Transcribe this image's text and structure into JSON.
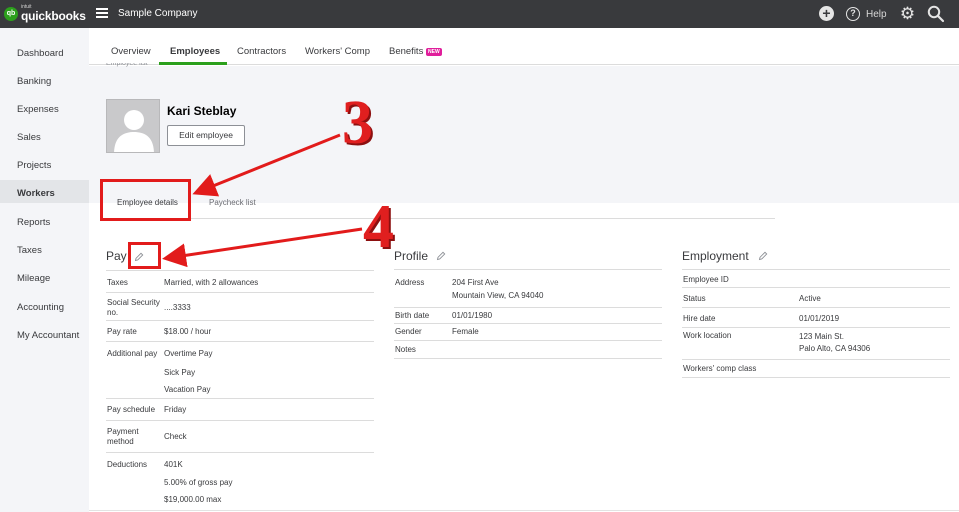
{
  "app": {
    "logo_intuit": "intuit",
    "logo_name": "quickbooks",
    "logo_mark": "qb",
    "company_name": "Sample Company",
    "help_label": "Help",
    "icons": [
      "hamburger-menu-icon",
      "plus-icon",
      "help-icon",
      "gear-icon",
      "search-icon"
    ]
  },
  "sidebar": {
    "items": [
      {
        "label": "Dashboard"
      },
      {
        "label": "Banking"
      },
      {
        "label": "Expenses"
      },
      {
        "label": "Sales"
      },
      {
        "label": "Projects"
      },
      {
        "label": "Workers",
        "active": true
      },
      {
        "label": "Reports"
      },
      {
        "label": "Taxes"
      },
      {
        "label": "Mileage"
      },
      {
        "label": "Accounting"
      },
      {
        "label": "My Accountant"
      }
    ]
  },
  "tabs": [
    {
      "label": "Overview"
    },
    {
      "label": "Employees",
      "active": true
    },
    {
      "label": "Contractors"
    },
    {
      "label": "Workers' Comp"
    },
    {
      "label": "Benefits",
      "badge": "NEW"
    }
  ],
  "breadcrumb_partial": "Employee list",
  "employee": {
    "name": "Kari Steblay",
    "edit_label": "Edit employee"
  },
  "subtabs": [
    {
      "label": "Employee details",
      "active": true
    },
    {
      "label": "Paycheck list"
    }
  ],
  "pay": {
    "title": "Pay",
    "rows": [
      {
        "label": "Taxes",
        "value": "Married, with 2 allowances"
      },
      {
        "label": "Social Security no.",
        "value": "....3333"
      },
      {
        "label": "Pay rate",
        "value": "$18.00 / hour"
      },
      {
        "label": "Additional pay",
        "values": [
          "Overtime Pay",
          "Sick Pay",
          "Vacation Pay"
        ]
      },
      {
        "label": "Pay schedule",
        "value": "Friday"
      },
      {
        "label": "Payment method",
        "value": "Check"
      },
      {
        "label": "Deductions",
        "values": [
          "401K",
          "5.00% of gross pay",
          "$19,000.00 max"
        ]
      }
    ]
  },
  "profile": {
    "title": "Profile",
    "rows": [
      {
        "label": "Address",
        "values": [
          "204 First Ave",
          "Mountain View, CA 94040"
        ]
      },
      {
        "label": "Birth date",
        "value": "01/01/1980"
      },
      {
        "label": "Gender",
        "value": "Female"
      },
      {
        "label": "Notes",
        "value": ""
      }
    ]
  },
  "employment": {
    "title": "Employment",
    "rows": [
      {
        "label": "Employee ID",
        "value": ""
      },
      {
        "label": "Status",
        "value": "Active"
      },
      {
        "label": "Hire date",
        "value": "01/01/2019"
      },
      {
        "label": "Work location",
        "values": [
          "123 Main St.",
          "Palo Alto, CA 94306"
        ]
      },
      {
        "label": "Workers' comp class",
        "value": ""
      }
    ]
  },
  "annotations": {
    "step3": "3",
    "step4": "4",
    "color": "#e21b1b"
  },
  "colors": {
    "topbar": "#393a3d",
    "brand_green": "#2ca01c",
    "sidebar_bg": "#f4f5f8",
    "new_badge": "#e01e9b"
  }
}
